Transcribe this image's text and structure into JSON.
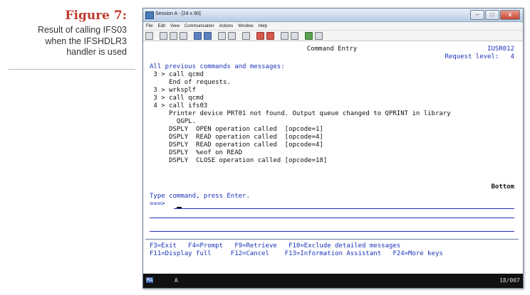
{
  "caption": {
    "title": "Figure 7:",
    "lines": [
      "Result of calling IFS03",
      "when the IFSHDLR3",
      "handler is used"
    ]
  },
  "window": {
    "title": "Session A - [24 x 80]",
    "buttons": {
      "minimize": "–",
      "maximize": "□",
      "close": "x"
    }
  },
  "menu": [
    "File",
    "Edit",
    "View",
    "Communication",
    "Actions",
    "Window",
    "Help"
  ],
  "terminal": {
    "screen_title": "Command Entry",
    "system_name": "IUSR012",
    "request_level": "Request level:   4",
    "section_header": "All previous commands and messages:",
    "lines": [
      " 3 > call qcmd",
      "     End of requests.",
      " 3 > wrksplf",
      " 3 > call qcmd",
      " 4 > call ifs03",
      "     Printer device PRT01 not found. Output queue changed to QPRINT in library",
      "       QGPL.",
      "     DSPLY  OPEN operation called  [opcode=1]",
      "     DSPLY  READ operation called  [opcode=4]",
      "     DSPLY  READ operation called  [opcode=4]",
      "     DSPLY  %eof on READ",
      "     DSPLY  CLOSE operation called [opcode=18]"
    ],
    "bottom_label": "Bottom",
    "prompt_text": "Type command, press Enter.",
    "prompt_arrow": "===>",
    "fkeys_row1": "F3=Exit   F4=Prompt   F9=Retrieve   F10=Exclude detailed messages",
    "fkeys_row2": "F11=Display full     F12=Cancel    F13=Information Assistant   F24=More keys"
  },
  "status": {
    "mode": "MA",
    "indicator": "A",
    "cursor_pos": "18/007"
  },
  "colors": {
    "caption_title": "#c0392b",
    "terminal_blue": "#1a32b8",
    "status_bg": "#111111"
  }
}
